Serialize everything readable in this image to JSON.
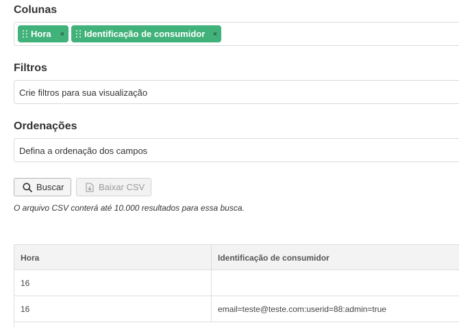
{
  "sections": {
    "columns_title": "Colunas",
    "filters_title": "Filtros",
    "sort_title": "Ordenações"
  },
  "columns": {
    "tags": [
      {
        "label": "Hora",
        "remove": "×"
      },
      {
        "label": "Identificação de consumidor",
        "remove": "×"
      }
    ],
    "tag_color": "#41b27a"
  },
  "filters": {
    "placeholder": "Crie filtros para sua visualização"
  },
  "sort": {
    "placeholder": "Defina a ordenação dos campos"
  },
  "actions": {
    "search_label": "Buscar",
    "search_icon": "search-icon",
    "download_label": "Baixar CSV",
    "download_icon": "download-file-icon",
    "download_disabled": true
  },
  "note": "O arquivo CSV conterá até 10.000 resultados para essa busca.",
  "table": {
    "headers": [
      "Hora",
      "Identificação de consumidor"
    ],
    "rows": [
      [
        "16",
        ""
      ],
      [
        "16",
        "email=teste@teste.com:userid=88:admin=true"
      ]
    ]
  }
}
